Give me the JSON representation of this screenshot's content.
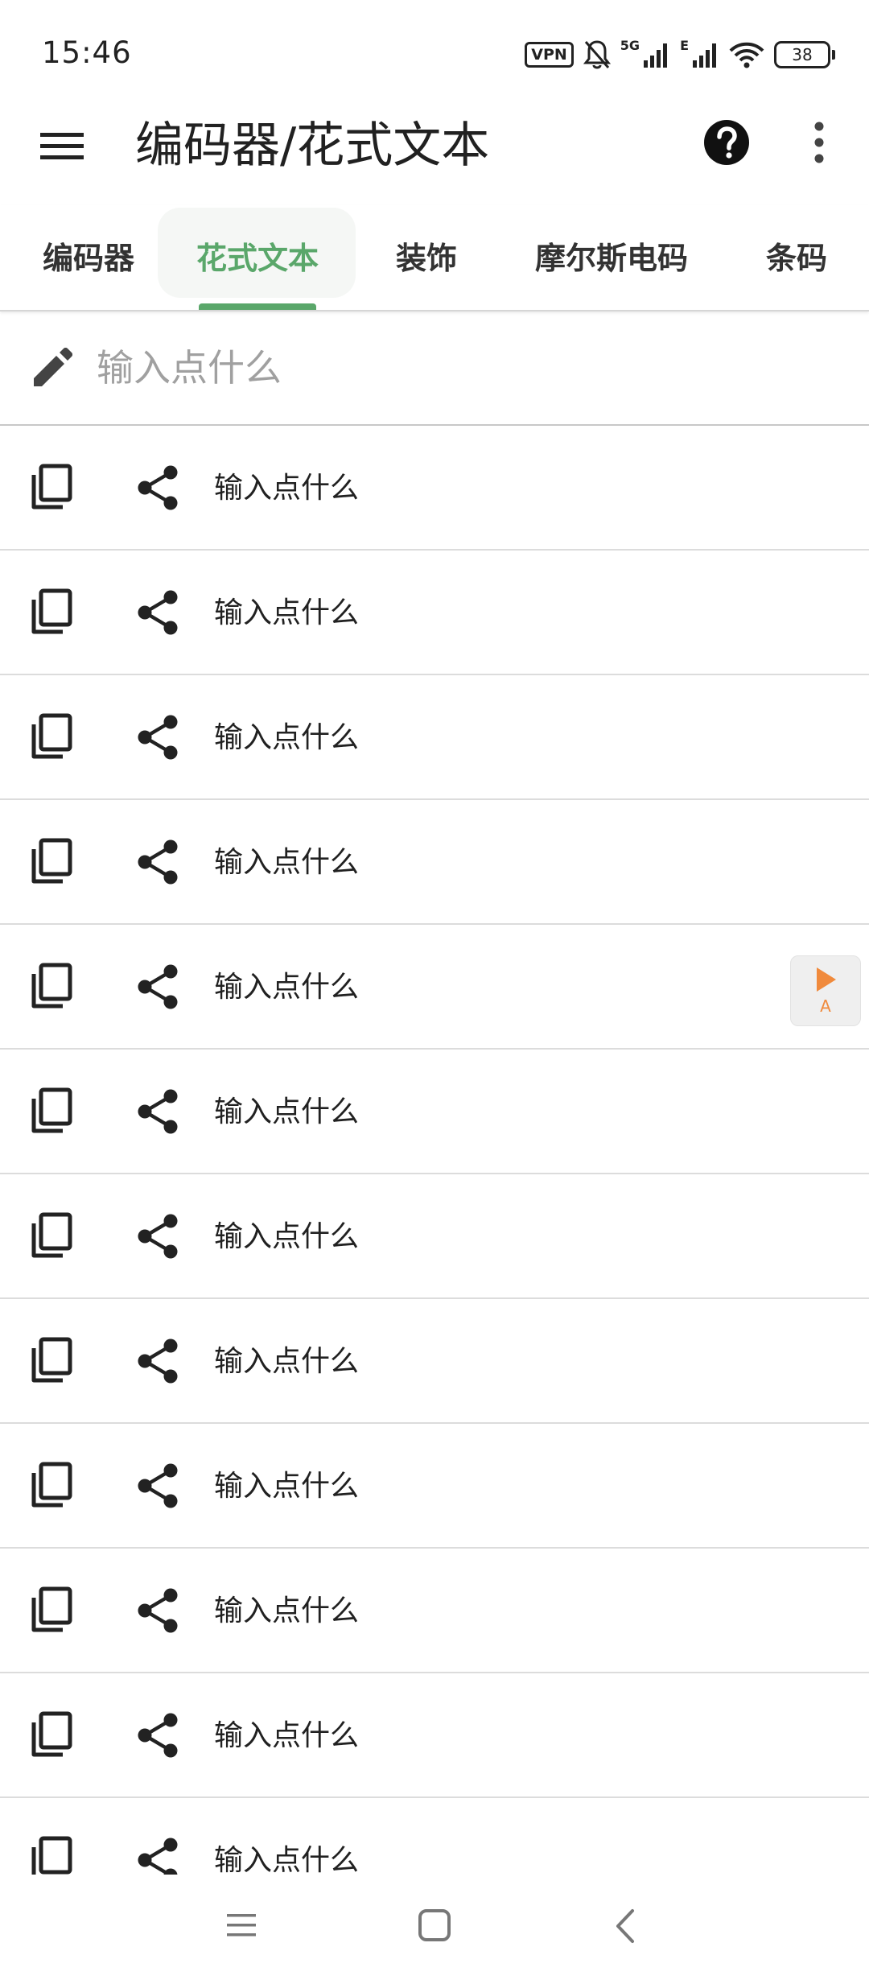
{
  "status_bar": {
    "time": "15:46",
    "vpn_label": "VPN",
    "network_5g": "5G",
    "network_e": "E",
    "battery": "38",
    "icons": [
      "bell-muted-icon",
      "signal-icon",
      "signal-icon",
      "wifi-icon"
    ]
  },
  "app_bar": {
    "title": "编码器/花式文本",
    "icons": [
      "menu-icon",
      "help-icon",
      "more-vert-icon"
    ]
  },
  "tabs": [
    {
      "label": "编码器",
      "active": false
    },
    {
      "label": "花式文本",
      "active": true
    },
    {
      "label": "装饰",
      "active": false
    },
    {
      "label": "摩尔斯电码",
      "active": false
    },
    {
      "label": "条码",
      "active": false
    }
  ],
  "input": {
    "placeholder": "输入点什么",
    "value": "",
    "icon": "pencil-icon"
  },
  "list": {
    "items": [
      {
        "text": "输入点什么"
      },
      {
        "text": "输入点什么"
      },
      {
        "text": "输入点什么"
      },
      {
        "text": "输入点什么"
      },
      {
        "text": "输入点什么"
      },
      {
        "text": "输入点什么"
      },
      {
        "text": "输入点什么"
      },
      {
        "text": "输入点什么"
      },
      {
        "text": "输入点什么"
      },
      {
        "text": "输入点什么"
      },
      {
        "text": "输入点什么"
      },
      {
        "text": "输入点什么"
      }
    ],
    "item_icons": [
      "copy-icon",
      "share-icon"
    ]
  },
  "float_widget": {
    "label": "A",
    "icon": "play-icon"
  },
  "nav_bar": {
    "icons": [
      "recent-apps-icon",
      "home-icon",
      "back-icon"
    ]
  },
  "colors": {
    "accent": "#5aa76a",
    "text": "#212121",
    "placeholder": "#a0a0a0",
    "float_accent": "#f08a3c"
  }
}
